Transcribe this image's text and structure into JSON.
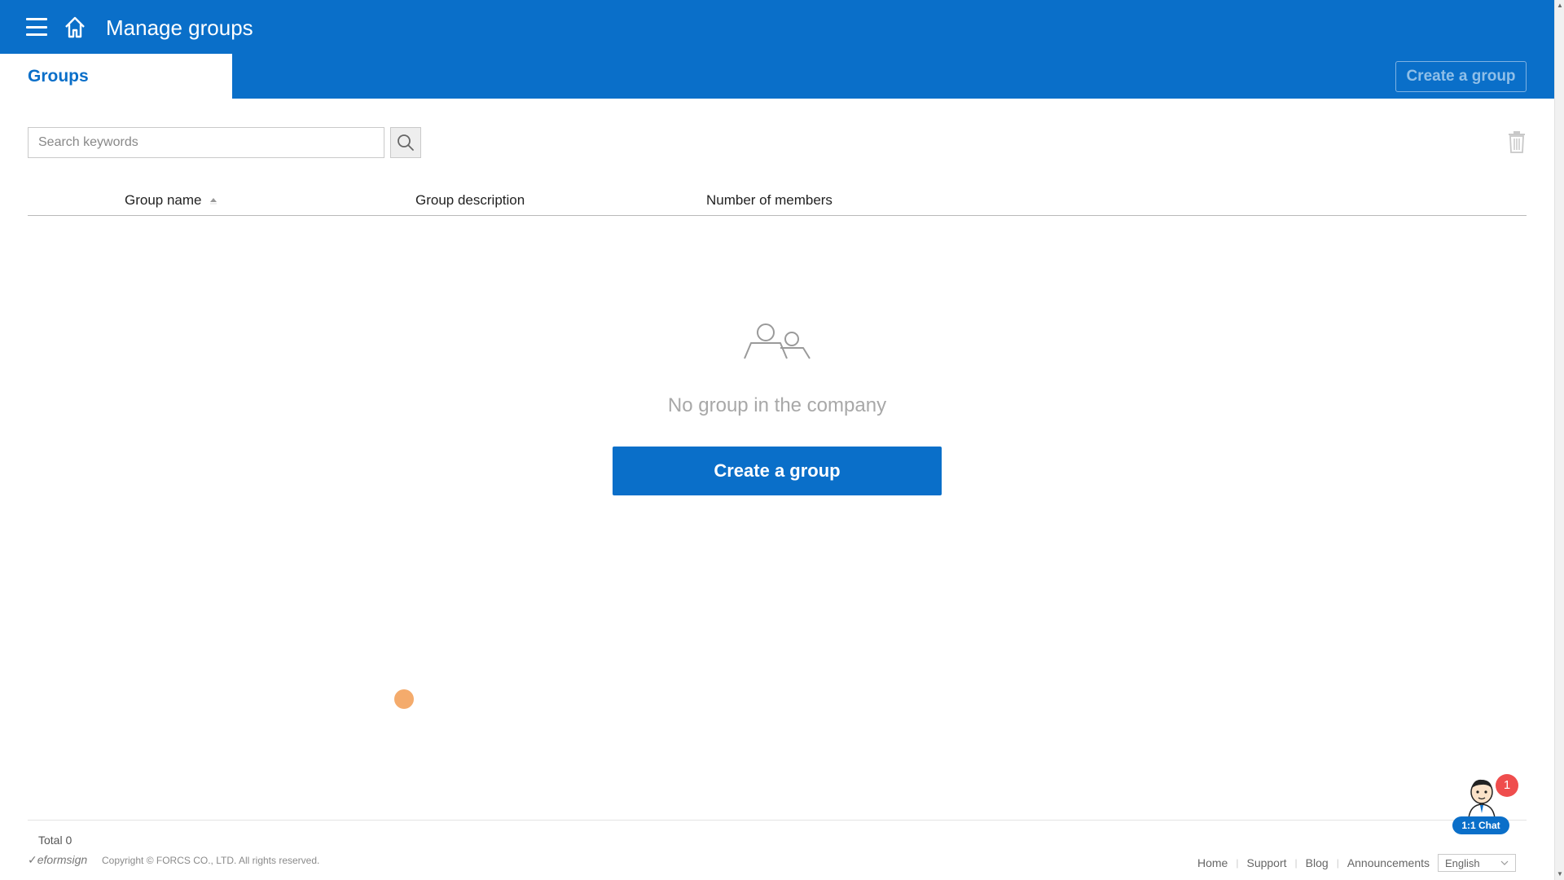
{
  "header": {
    "title": "Manage groups",
    "tab_label": "Groups",
    "create_button_label": "Create a group",
    "brand_color": "#0a6fc9"
  },
  "search": {
    "placeholder": "Search keywords",
    "value": ""
  },
  "table": {
    "columns": [
      "Group name",
      "Group description",
      "Number of members"
    ],
    "sort_column": "Group name",
    "sort_direction": "ascending",
    "rows": []
  },
  "empty_state": {
    "icon": "users-icon",
    "message": "No group in the company",
    "button_label": "Create a group"
  },
  "footer": {
    "total_label": "Total 0",
    "logo_text": "eformsign",
    "copyright": "Copyright © FORCS CO., LTD. All rights reserved.",
    "links": [
      "Home",
      "Support",
      "Blog",
      "Announcements"
    ],
    "language": "English"
  },
  "chat_widget": {
    "label": "1:1 Chat",
    "badge_count": "1"
  }
}
